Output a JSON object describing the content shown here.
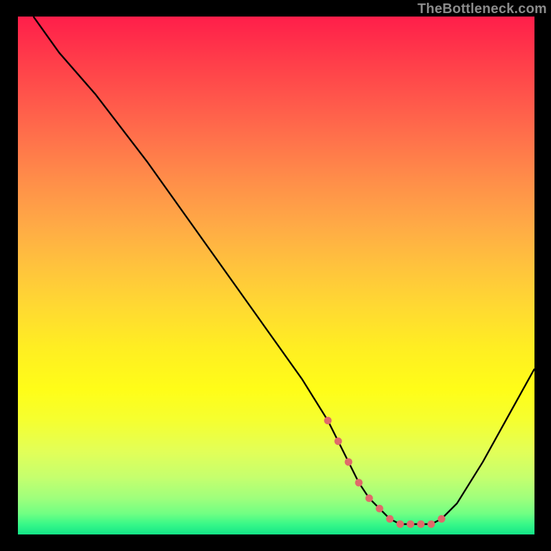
{
  "watermark": "TheBottleneck.com",
  "chart_data": {
    "type": "line",
    "title": "",
    "xlabel": "",
    "ylabel": "",
    "xlim": [
      0,
      100
    ],
    "ylim": [
      0,
      100
    ],
    "grid": false,
    "curve": {
      "name": "bottleneck-curve",
      "x": [
        3,
        8,
        15,
        25,
        35,
        45,
        55,
        60,
        62,
        64,
        66,
        68,
        70,
        72,
        74,
        76,
        78,
        80,
        82,
        85,
        90,
        95,
        100
      ],
      "y": [
        100,
        93,
        85,
        72,
        58,
        44,
        30,
        22,
        18,
        14,
        10,
        7,
        5,
        3,
        2,
        2,
        2,
        2,
        3,
        6,
        14,
        23,
        32
      ]
    },
    "markers": {
      "name": "optimal-range-dots",
      "color": "#e06a6a",
      "x": [
        60,
        62,
        64,
        66,
        68,
        70,
        72,
        74,
        76,
        78,
        80,
        82
      ],
      "y": [
        22,
        18,
        14,
        10,
        7,
        5,
        3,
        2,
        2,
        2,
        2,
        3
      ]
    },
    "background_gradient": {
      "top_color": "#ff1e4a",
      "bottom_color": "#14e588",
      "description": "vertical rainbow gradient red→orange→yellow→green"
    }
  }
}
